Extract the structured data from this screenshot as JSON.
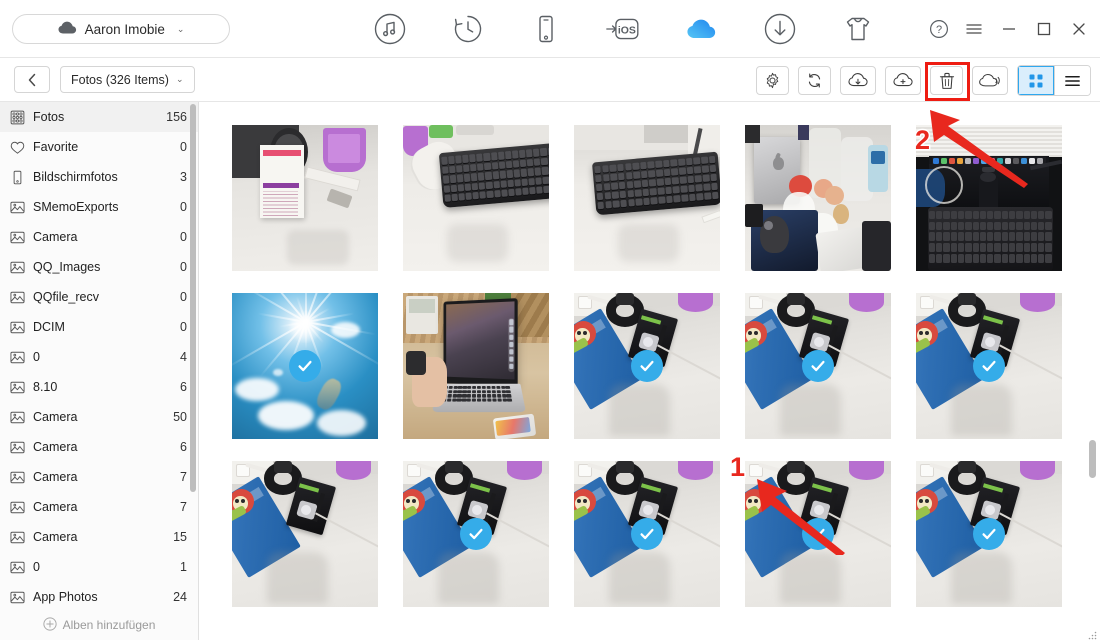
{
  "window": {
    "account": {
      "name": "Aaron  Imobie",
      "icon": "cloud-icon",
      "caret": "⌄"
    },
    "tabs": [
      {
        "name": "music-tab",
        "icon": "music-note-icon",
        "active": false
      },
      {
        "name": "history-tab",
        "icon": "clock-rotate-icon",
        "active": false
      },
      {
        "name": "device-tab",
        "icon": "phone-icon",
        "active": false
      },
      {
        "name": "to-ios-tab",
        "icon": "to-ios-icon",
        "label": "iOS",
        "active": false
      },
      {
        "name": "icloud-tab",
        "icon": "cloud-icon",
        "active": true
      },
      {
        "name": "download-tab",
        "icon": "download-circle-icon",
        "active": false
      },
      {
        "name": "ringtone-tab",
        "icon": "tshirt-icon",
        "active": false
      }
    ],
    "controls": [
      {
        "name": "help-button",
        "icon": "question-circle-icon",
        "glyph": "?"
      },
      {
        "name": "menu-button",
        "icon": "hamburger-icon",
        "glyph": "≡"
      },
      {
        "name": "minimize-button",
        "icon": "minimize-icon",
        "glyph": "−"
      },
      {
        "name": "maximize-button",
        "icon": "maximize-icon",
        "glyph": "□"
      },
      {
        "name": "close-button",
        "icon": "close-icon",
        "glyph": "✕"
      }
    ]
  },
  "subbar": {
    "back_glyph": "‹",
    "breadcrumb": "Fotos (326 Items)",
    "breadcrumb_caret": "⌄",
    "tools": [
      {
        "name": "settings-button",
        "icon": "gear-icon"
      },
      {
        "name": "refresh-button",
        "icon": "refresh-icon"
      },
      {
        "name": "download-cloud-button",
        "icon": "cloud-download-icon"
      },
      {
        "name": "upload-cloud-button",
        "icon": "cloud-add-icon"
      },
      {
        "name": "delete-button",
        "icon": "trash-icon",
        "highlighted": true
      },
      {
        "name": "share-cloud-button",
        "icon": "cloud-share-icon"
      }
    ],
    "views": [
      {
        "name": "grid-view-button",
        "icon": "grid-icon",
        "active": true
      },
      {
        "name": "list-view-button",
        "icon": "list-icon",
        "active": false
      }
    ]
  },
  "sidebar": {
    "add_album_label": "Alben hinzufügen",
    "add_album_icon": "plus-circle-icon",
    "items": [
      {
        "label": "Fotos",
        "count": "156",
        "icon": "photos-grid-icon",
        "active": true
      },
      {
        "label": "Favorite",
        "count": "0",
        "icon": "heart-icon",
        "active": false
      },
      {
        "label": "Bildschirmfotos",
        "count": "3",
        "icon": "phone-icon",
        "active": false
      },
      {
        "label": "SMemoExports",
        "count": "0",
        "icon": "album-icon",
        "active": false
      },
      {
        "label": "Camera",
        "count": "0",
        "icon": "album-icon",
        "active": false
      },
      {
        "label": "QQ_Images",
        "count": "0",
        "icon": "album-icon",
        "active": false
      },
      {
        "label": "QQfile_recv",
        "count": "0",
        "icon": "album-icon",
        "active": false
      },
      {
        "label": "DCIM",
        "count": "0",
        "icon": "album-icon",
        "active": false
      },
      {
        "label": "0",
        "count": "4",
        "icon": "album-icon",
        "active": false
      },
      {
        "label": "8.10",
        "count": "6",
        "icon": "album-icon",
        "active": false
      },
      {
        "label": "Camera",
        "count": "50",
        "icon": "album-icon",
        "active": false
      },
      {
        "label": "Camera",
        "count": "6",
        "icon": "album-icon",
        "active": false
      },
      {
        "label": "Camera",
        "count": "7",
        "icon": "album-icon",
        "active": false
      },
      {
        "label": "Camera",
        "count": "7",
        "icon": "album-icon",
        "active": false
      },
      {
        "label": "Camera",
        "count": "15",
        "icon": "album-icon",
        "active": false
      },
      {
        "label": "0",
        "count": "1",
        "icon": "album-icon",
        "active": false
      },
      {
        "label": "App Photos",
        "count": "24",
        "icon": "album-icon",
        "active": false
      }
    ]
  },
  "grid": {
    "photos": [
      {
        "name": "photo-milk-carton-fan",
        "selected": false,
        "scene": "desk-milk-carton"
      },
      {
        "name": "photo-keyboard-wide",
        "selected": false,
        "scene": "keyboard-a"
      },
      {
        "name": "photo-keyboard-close",
        "selected": false,
        "scene": "keyboard-b"
      },
      {
        "name": "photo-macmini-apples",
        "selected": false,
        "scene": "macmini"
      },
      {
        "name": "photo-lg-monitor",
        "selected": false,
        "scene": "monitor"
      },
      {
        "name": "photo-sun-sky",
        "selected": true,
        "scene": "sky"
      },
      {
        "name": "photo-macbook-hand",
        "selected": false,
        "scene": "macbook"
      },
      {
        "name": "photo-desk-mousepad-1",
        "selected": true,
        "scene": "mousepad"
      },
      {
        "name": "photo-desk-mousepad-2",
        "selected": true,
        "scene": "mousepad"
      },
      {
        "name": "photo-desk-mousepad-3",
        "selected": true,
        "scene": "mousepad"
      },
      {
        "name": "photo-desk-mousepad-4",
        "selected": false,
        "scene": "mousepad"
      },
      {
        "name": "photo-desk-mousepad-5",
        "selected": true,
        "scene": "mousepad"
      },
      {
        "name": "photo-desk-mousepad-6",
        "selected": true,
        "scene": "mousepad"
      },
      {
        "name": "photo-desk-mousepad-7",
        "selected": true,
        "scene": "mousepad"
      },
      {
        "name": "photo-desk-mousepad-8",
        "selected": true,
        "scene": "mousepad"
      }
    ]
  },
  "annotations": {
    "step_one": "1",
    "step_two": "2",
    "arrow_color": "#e8281e",
    "highlight_color": "#ee1c12"
  },
  "colors": {
    "accent_blue": "#35ace9",
    "selection_border": "#35a8ef",
    "active_tab_blue": "#3aaaf0",
    "view_active_bg": "#daeefc"
  }
}
